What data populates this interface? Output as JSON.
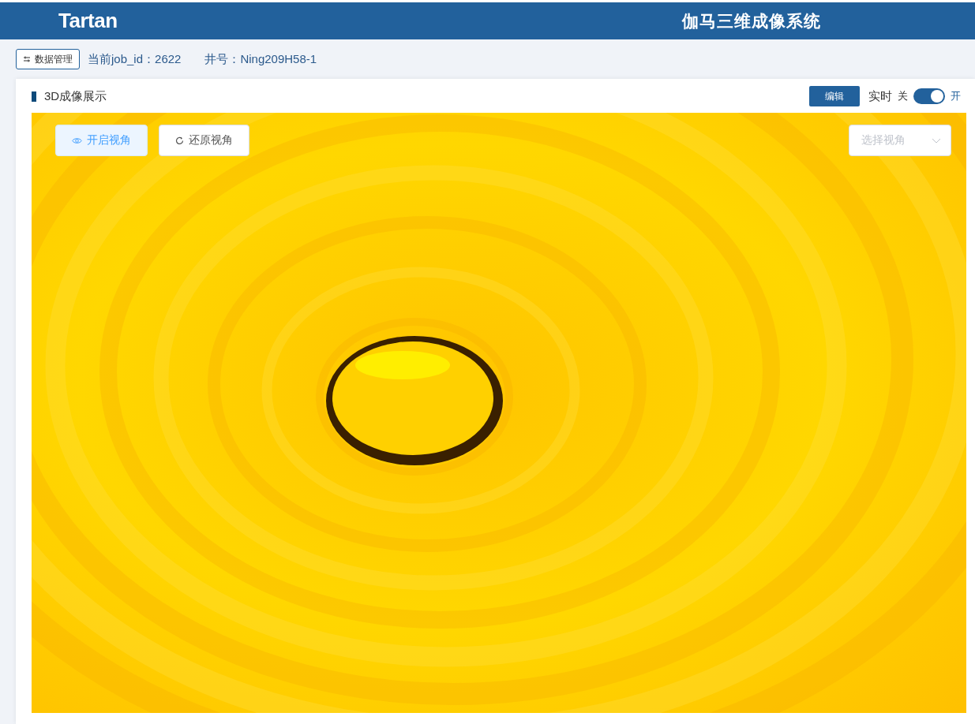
{
  "header": {
    "logo": "Tartan",
    "title": "伽马三维成像系统"
  },
  "toolbar": {
    "data_button": "数据管理",
    "job_label": "当前job_id：2622",
    "well_label": "井号：Ning209H58-1"
  },
  "panel": {
    "title": "3D成像展示",
    "edit_button": "编辑",
    "realtime_label": "实时",
    "off_label": "关",
    "on_label": "开",
    "realtime_on": true
  },
  "viewer": {
    "kind": "picture",
    "buttons": [
      {
        "label": "开启视角",
        "kind": "eye",
        "selected": true
      },
      {
        "label": "还原视角",
        "kind": "refresh",
        "selected": false
      }
    ],
    "view_select": {
      "placeholder": "选择视角"
    }
  }
}
